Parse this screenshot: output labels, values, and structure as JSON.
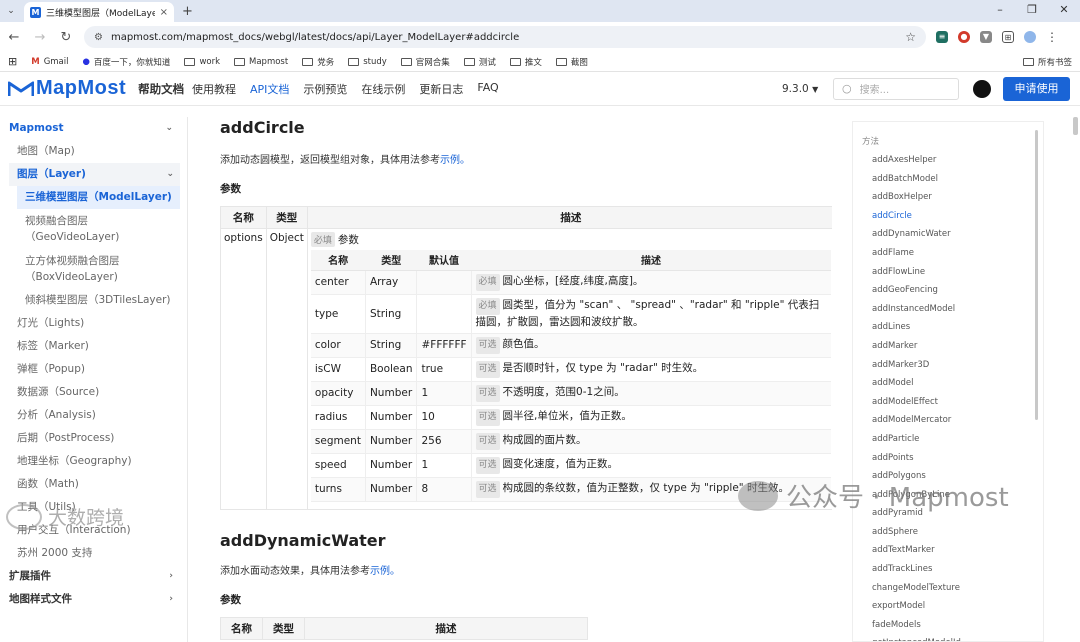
{
  "browser": {
    "tab_title": "三维模型图层（ModelLayer)",
    "url": "mapmost.com/mapmost_docs/webgl/latest/docs/api/Layer_ModelLayer#addcircle",
    "bookmarks": [
      "Gmail",
      "百度一下，你就知道",
      "work",
      "Mapmost",
      "党务",
      "study",
      "官网合集",
      "测试",
      "推文",
      "截图"
    ],
    "bookmarks_right": "所有书签"
  },
  "header": {
    "brand": "MapMost",
    "help": "帮助文档",
    "nav": [
      "使用教程",
      "API文档",
      "示例预览",
      "在线示例",
      "更新日志",
      "FAQ"
    ],
    "active_nav": "API文档",
    "version": "9.3.0",
    "search_placeholder": "搜索...",
    "apply_label": "申请使用",
    "accent": "#1a64d6"
  },
  "sidebar": {
    "section": "Mapmost",
    "items": {
      "map": "地图（Map)",
      "layer": "图层（Layer)",
      "model_layer": "三维模型图层（ModelLayer)",
      "geo_video_1": "视频融合图层",
      "geo_video_2": "（GeoVideoLayer)",
      "box_video_1": "立方体视频融合图层",
      "box_video_2": "（BoxVideoLayer)",
      "tiles": "倾斜模型图层（3DTilesLayer)",
      "lights": "灯光（Lights)",
      "marker": "标签（Marker)",
      "popup": "弹框（Popup)",
      "source": "数据源（Source)",
      "analysis": "分析（Analysis)",
      "postprocess": "后期（PostProcess)",
      "geography": "地理坐标（Geography)",
      "math": "函数（Math)",
      "utils": "工具（Utils)",
      "interaction": "用户交互（Interaction)",
      "suzhou": "苏州 2000 支持"
    },
    "plugins": "扩展插件",
    "styles": "地图样式文件"
  },
  "content": {
    "title1": "addCircle",
    "desc1": "添加动态圆模型，返回模型组对象，具体用法参考",
    "link": "示例。",
    "params": "参数",
    "th_name": "名称",
    "th_type": "类型",
    "th_desc": "描述",
    "th_default": "默认值",
    "options_name": "options",
    "options_type": "Object",
    "required": "必填",
    "optional": "可选",
    "options_desc": "参数",
    "rows": [
      {
        "name": "center",
        "type": "Array",
        "def": "",
        "badge": "必填",
        "desc": "圆心坐标，[经度,纬度,高度]。"
      },
      {
        "name": "type",
        "type": "String",
        "def": "",
        "badge": "必填",
        "desc": "圆类型，值分为 \"scan\" 、 \"spread\" 、\"radar\" 和 \"ripple\" 代表扫描圆，扩散圆，雷达圆和波纹扩散。"
      },
      {
        "name": "color",
        "type": "String",
        "def": "#FFFFFF",
        "badge": "可选",
        "desc": "颜色值。"
      },
      {
        "name": "isCW",
        "type": "Boolean",
        "def": "true",
        "badge": "可选",
        "desc": "是否顺时针，仅 type 为 \"radar\" 时生效。"
      },
      {
        "name": "opacity",
        "type": "Number",
        "def": "1",
        "badge": "可选",
        "desc": "不透明度，范围0-1之间。"
      },
      {
        "name": "radius",
        "type": "Number",
        "def": "10",
        "badge": "可选",
        "desc": "圆半径,单位米，值为正数。"
      },
      {
        "name": "segment",
        "type": "Number",
        "def": "256",
        "badge": "可选",
        "desc": "构成圆的面片数。"
      },
      {
        "name": "speed",
        "type": "Number",
        "def": "1",
        "badge": "可选",
        "desc": "圆变化速度，值为正数。"
      },
      {
        "name": "turns",
        "type": "Number",
        "def": "8",
        "badge": "可选",
        "desc": "构成圆的条纹数，值为正整数，仅 type 为 \"ripple\" 时生效。"
      }
    ],
    "title2": "addDynamicWater",
    "desc2": "添加水面动态效果，具体用法参考",
    "params2": "参数"
  },
  "toc": {
    "head": "方法",
    "items": [
      "addAxesHelper",
      "addBatchModel",
      "addBoxHelper",
      "addCircle",
      "addDynamicWater",
      "addFlame",
      "addFlowLine",
      "addGeoFencing",
      "addInstancedModel",
      "addLines",
      "addMarker",
      "addMarker3D",
      "addModel",
      "addModelEffect",
      "addModelMercator",
      "addParticle",
      "addPoints",
      "addPolygons",
      "addPolygonByLine",
      "addPyramid",
      "addSphere",
      "addTextMarker",
      "addTrackLines",
      "changeModelTexture",
      "exportModel",
      "fadeModels",
      "getInstancedModelId"
    ],
    "active": "addCircle"
  },
  "watermark": {
    "main": "公众号 · Mapmost",
    "corner": "大数跨境"
  }
}
